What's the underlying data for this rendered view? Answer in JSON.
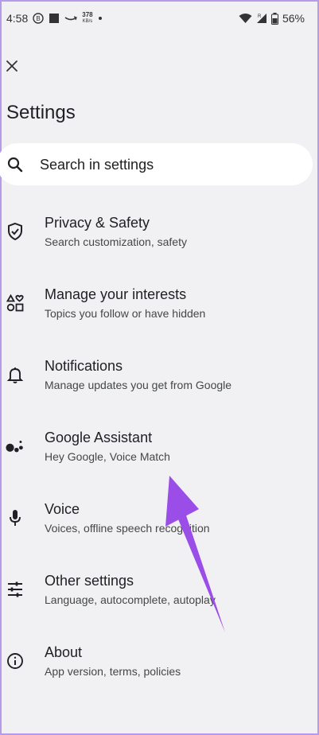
{
  "status_bar": {
    "time": "4:58",
    "speed_value": "378",
    "speed_unit": "KB/s",
    "battery": "56%"
  },
  "page": {
    "title": "Settings"
  },
  "search": {
    "label": "Search in settings"
  },
  "items": [
    {
      "label": "Privacy & Safety",
      "sub": "Search customization, safety",
      "icon": "shield-icon"
    },
    {
      "label": "Manage your interests",
      "sub": "Topics you follow or have hidden",
      "icon": "interests-icon"
    },
    {
      "label": "Notifications",
      "sub": "Manage updates you get from Google",
      "icon": "bell-icon"
    },
    {
      "label": "Google Assistant",
      "sub": "Hey Google, Voice Match",
      "icon": "assistant-icon"
    },
    {
      "label": "Voice",
      "sub": "Voices, offline speech recognition",
      "icon": "mic-icon"
    },
    {
      "label": "Other settings",
      "sub": "Language, autocomplete, autoplay",
      "icon": "sliders-icon"
    },
    {
      "label": "About",
      "sub": "App version, terms, policies",
      "icon": "info-icon"
    }
  ],
  "colors": {
    "background": "#f1f1f3",
    "arrow": "#9b4de8"
  }
}
